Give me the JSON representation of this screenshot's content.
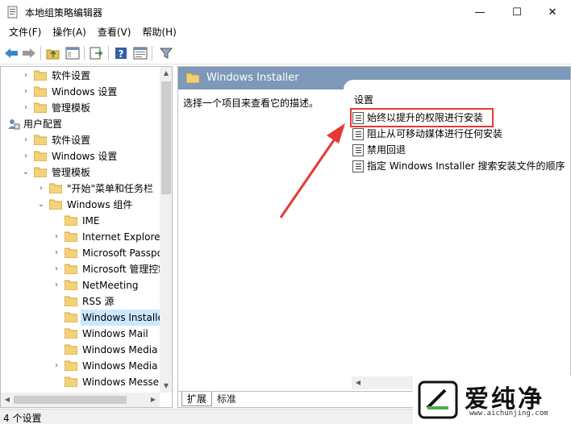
{
  "window": {
    "title": "本地组策略编辑器",
    "minimize": "—",
    "maximize": "☐",
    "close": "✕"
  },
  "menu": [
    "文件(F)",
    "操作(A)",
    "查看(V)",
    "帮助(H)"
  ],
  "toolbar_icons": [
    "back-icon",
    "forward-icon",
    "up-folder-icon",
    "show-hide-tree-icon",
    "export-icon",
    "help-icon",
    "properties-icon",
    "filter-icon"
  ],
  "tree": {
    "items": [
      {
        "label": "软件设置",
        "expand": "›"
      },
      {
        "label": "Windows 设置",
        "expand": "›"
      },
      {
        "label": "管理模板",
        "expand": "›"
      },
      {
        "label": "用户配置",
        "expand": ""
      },
      {
        "label": "软件设置",
        "expand": "›"
      },
      {
        "label": "Windows 设置",
        "expand": "›"
      },
      {
        "label": "管理模板",
        "expand": "⌄"
      },
      {
        "label": "\"开始\"菜单和任务栏",
        "expand": "›"
      },
      {
        "label": "Windows 组件",
        "expand": "⌄"
      },
      {
        "label": "IME",
        "expand": ""
      },
      {
        "label": "Internet Explorer",
        "expand": "›"
      },
      {
        "label": "Microsoft Passport",
        "expand": "›"
      },
      {
        "label": "Microsoft 管理控制台",
        "expand": "›"
      },
      {
        "label": "NetMeeting",
        "expand": "›"
      },
      {
        "label": "RSS 源",
        "expand": ""
      },
      {
        "label": "Windows Installer",
        "expand": ""
      },
      {
        "label": "Windows Mail",
        "expand": ""
      },
      {
        "label": "Windows Media Ce",
        "expand": ""
      },
      {
        "label": "Windows Media Pla",
        "expand": "›"
      },
      {
        "label": "Windows Messenge",
        "expand": ""
      }
    ]
  },
  "right_pane": {
    "header_title": "Windows Installer",
    "description": "选择一个项目来查看它的描述。",
    "settings_header": "设置",
    "settings": [
      "始终以提升的权限进行安装",
      "阻止从可移动媒体进行任何安装",
      "禁用回退",
      "指定 Windows Installer 搜索安装文件的顺序"
    ],
    "tabs": [
      "扩展",
      "标准"
    ]
  },
  "status": "4 个设置",
  "watermark": {
    "brand": "爱纯净",
    "url": "www.aichunjing.com"
  },
  "colors": {
    "header_bg": "#7d98b8",
    "selection": "#cce8ff",
    "annotation_red": "#e53935"
  }
}
